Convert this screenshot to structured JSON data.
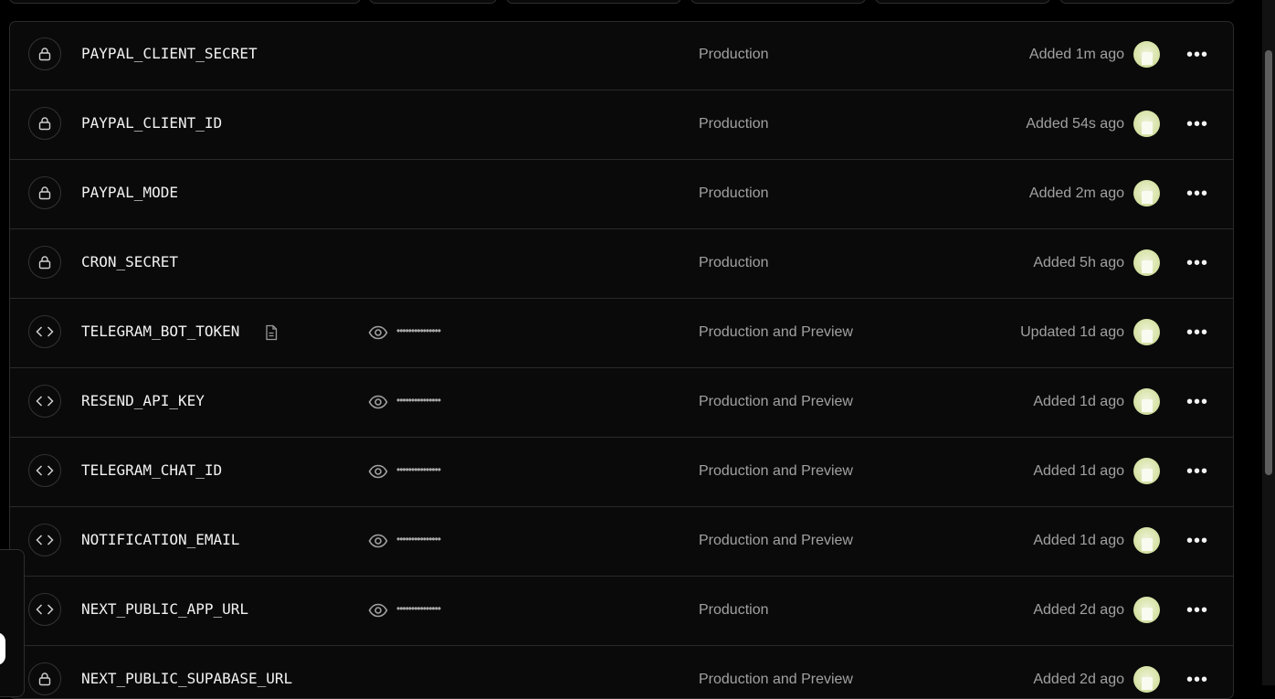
{
  "rows": [
    {
      "type_icon": "lock-icon",
      "name": "PAYPAL_CLIENT_SECRET",
      "has_note": false,
      "masked": "",
      "environment": "Production",
      "added": "Added 1m ago"
    },
    {
      "type_icon": "lock-icon",
      "name": "PAYPAL_CLIENT_ID",
      "has_note": false,
      "masked": "",
      "environment": "Production",
      "added": "Added 54s ago"
    },
    {
      "type_icon": "lock-icon",
      "name": "PAYPAL_MODE",
      "has_note": false,
      "masked": "",
      "environment": "Production",
      "added": "Added 2m ago"
    },
    {
      "type_icon": "lock-icon",
      "name": "CRON_SECRET",
      "has_note": false,
      "masked": "",
      "environment": "Production",
      "added": "Added 5h ago"
    },
    {
      "type_icon": "code-icon",
      "name": "TELEGRAM_BOT_TOKEN",
      "has_note": true,
      "masked": "•••••••••••••••",
      "environment": "Production and Preview",
      "added": "Updated 1d ago"
    },
    {
      "type_icon": "code-icon",
      "name": "RESEND_API_KEY",
      "has_note": false,
      "masked": "•••••••••••••••",
      "environment": "Production and Preview",
      "added": "Added 1d ago"
    },
    {
      "type_icon": "code-icon",
      "name": "TELEGRAM_CHAT_ID",
      "has_note": false,
      "masked": "•••••••••••••••",
      "environment": "Production and Preview",
      "added": "Added 1d ago"
    },
    {
      "type_icon": "code-icon",
      "name": "NOTIFICATION_EMAIL",
      "has_note": false,
      "masked": "•••••••••••••••",
      "environment": "Production and Preview",
      "added": "Added 1d ago"
    },
    {
      "type_icon": "code-icon",
      "name": "NEXT_PUBLIC_APP_URL",
      "has_note": false,
      "masked": "•••••••••••••••",
      "environment": "Production",
      "added": "Added 2d ago"
    },
    {
      "type_icon": "lock-icon",
      "name": "NEXT_PUBLIC_SUPABASE_URL",
      "has_note": false,
      "masked": "",
      "environment": "Production and Preview",
      "added": "Added 2d ago"
    }
  ],
  "menu_glyph": "•••"
}
